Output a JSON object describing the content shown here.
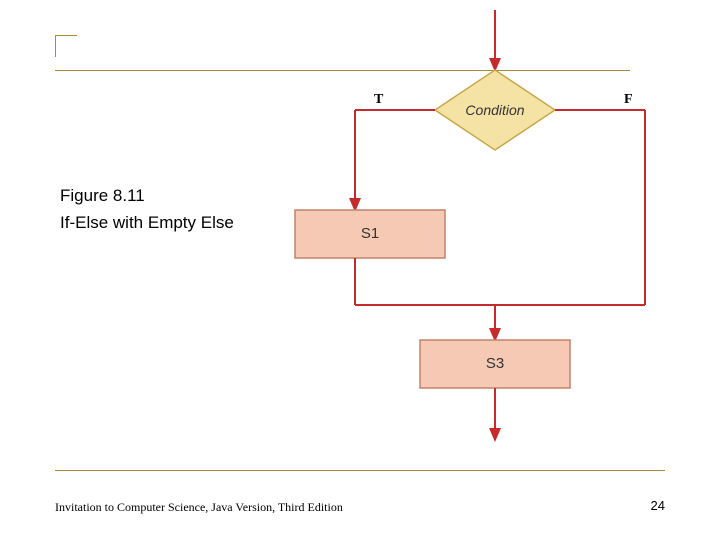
{
  "caption": {
    "line1": "Figure 8.11",
    "line2": "If-Else with Empty Else"
  },
  "footer": {
    "text": "Invitation to Computer Science, Java Version, Third Edition",
    "page": "24"
  },
  "diagram": {
    "condition": "Condition",
    "true_label": "T",
    "false_label": "F",
    "box_s1": "S1",
    "box_s3": "S3"
  },
  "colors": {
    "rule": "#a88a3a",
    "arrow": "#c72a2a",
    "diamond_fill": "#f5e3a6",
    "diamond_stroke": "#c9a84a",
    "box_fill": "#f6c9b4",
    "box_stroke": "#c2826a"
  }
}
